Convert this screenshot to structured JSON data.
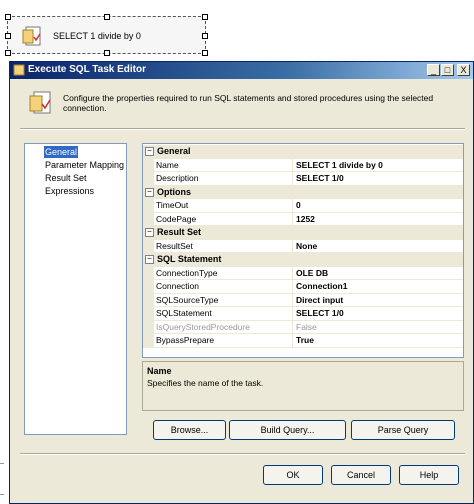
{
  "task_box": {
    "name": "SELECT 1 divide by 0",
    "icon": "sql-task-icon"
  },
  "window": {
    "title": "Execute SQL Task Editor",
    "min_label": "_",
    "max_label": "□",
    "close_label": "X"
  },
  "header": {
    "text": "Configure the properties required to run SQL statements and stored procedures using the selected connection."
  },
  "nav": {
    "items": [
      {
        "label": "General",
        "selected": true
      },
      {
        "label": "Parameter Mapping",
        "selected": false
      },
      {
        "label": "Result Set",
        "selected": false
      },
      {
        "label": "Expressions",
        "selected": false
      }
    ]
  },
  "grid": {
    "categories": {
      "general": "General",
      "options": "Options",
      "result_set": "Result Set",
      "sql_statement": "SQL Statement"
    },
    "toggle": "−",
    "props": {
      "name": {
        "label": "Name",
        "value": "SELECT 1 divide by 0"
      },
      "description": {
        "label": "Description",
        "value": "SELECT 1/0"
      },
      "timeout": {
        "label": "TimeOut",
        "value": "0"
      },
      "codepage": {
        "label": "CodePage",
        "value": "1252"
      },
      "resultset": {
        "label": "ResultSet",
        "value": "None"
      },
      "connectiontype": {
        "label": "ConnectionType",
        "value": "OLE DB"
      },
      "connection": {
        "label": "Connection",
        "value": "Connection1"
      },
      "sqlsourcetype": {
        "label": "SQLSourceType",
        "value": "Direct input"
      },
      "sqlstatement": {
        "label": "SQLStatement",
        "value": "SELECT 1/0"
      },
      "isqueryproc": {
        "label": "IsQueryStoredProcedure",
        "value": "False"
      },
      "bypassprepare": {
        "label": "BypassPrepare",
        "value": "True"
      }
    }
  },
  "description_pane": {
    "title": "Name",
    "text": "Specifies the name of the task."
  },
  "buttons": {
    "browse": "Browse...",
    "build_query": "Build Query...",
    "parse_query": "Parse Query",
    "ok": "OK",
    "cancel": "Cancel",
    "help": "Help"
  },
  "colors": {
    "selection": "#316ac5",
    "dialog_bg": "#ece9d8",
    "titlebar": "#0a246a"
  }
}
